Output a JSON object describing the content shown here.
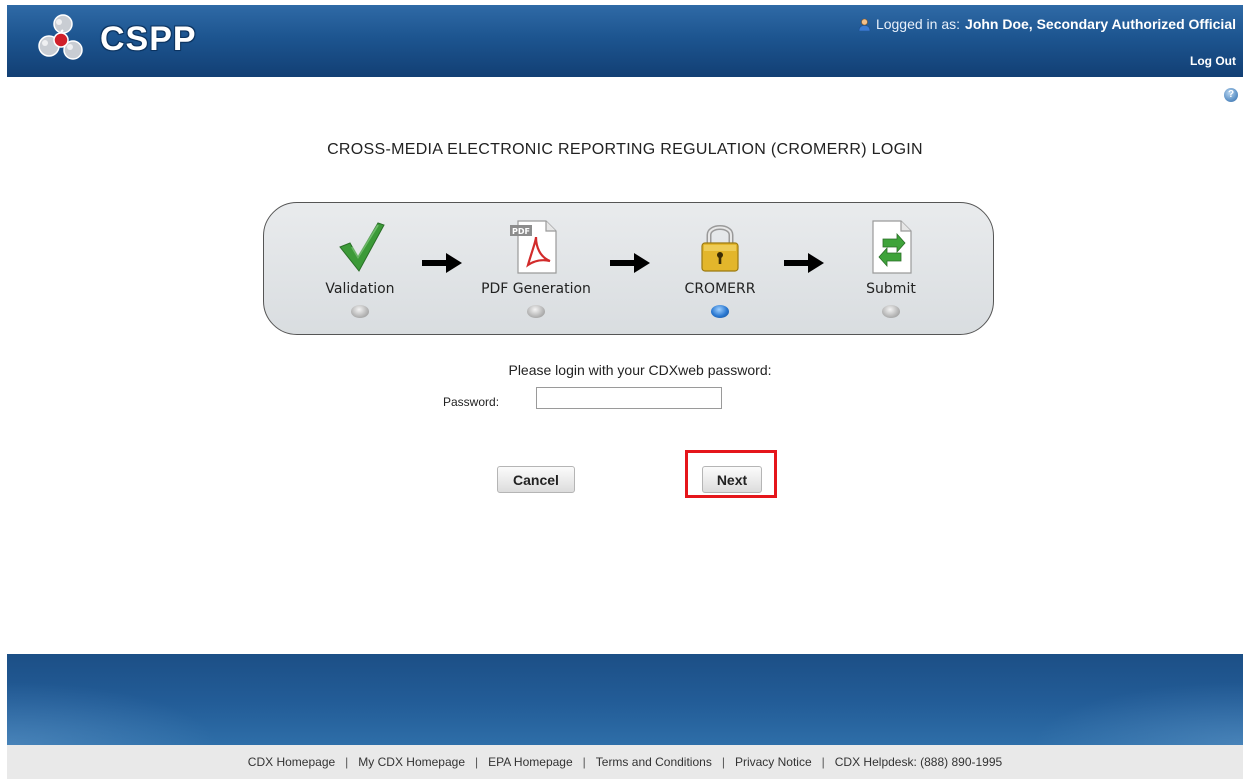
{
  "header": {
    "logo_text": "CSPP",
    "logged_in_prefix": "Logged in as:",
    "user_name": "John Doe, Secondary Authorized Official",
    "logout_label": "Log Out"
  },
  "help": {
    "icon_glyph": "?"
  },
  "page": {
    "title": "CROSS-MEDIA ELECTRONIC REPORTING REGULATION (CROMERR) LOGIN"
  },
  "wizard": {
    "steps": [
      {
        "label": "Validation",
        "icon": "checkmark-icon",
        "active": false
      },
      {
        "label": "PDF Generation",
        "icon": "pdf-document-icon",
        "active": false
      },
      {
        "label": "CROMERR",
        "icon": "padlock-icon",
        "active": true
      },
      {
        "label": "Submit",
        "icon": "submit-document-icon",
        "active": false
      }
    ]
  },
  "login": {
    "prompt": "Please login with your CDXweb password:",
    "password_label": "Password:",
    "password_value": ""
  },
  "buttons": {
    "cancel_label": "Cancel",
    "next_label": "Next"
  },
  "footer": {
    "links": [
      {
        "label": "CDX Homepage"
      },
      {
        "label": "My CDX Homepage"
      },
      {
        "label": "EPA Homepage"
      },
      {
        "label": "Terms and Conditions"
      },
      {
        "label": "Privacy Notice"
      },
      {
        "label": "CDX Helpdesk: (888) 890-1995"
      }
    ],
    "separator": "|"
  },
  "colors": {
    "header_blue": "#1d5590",
    "highlight_red": "#e5161b",
    "active_step_blue": "#2a78d1"
  }
}
